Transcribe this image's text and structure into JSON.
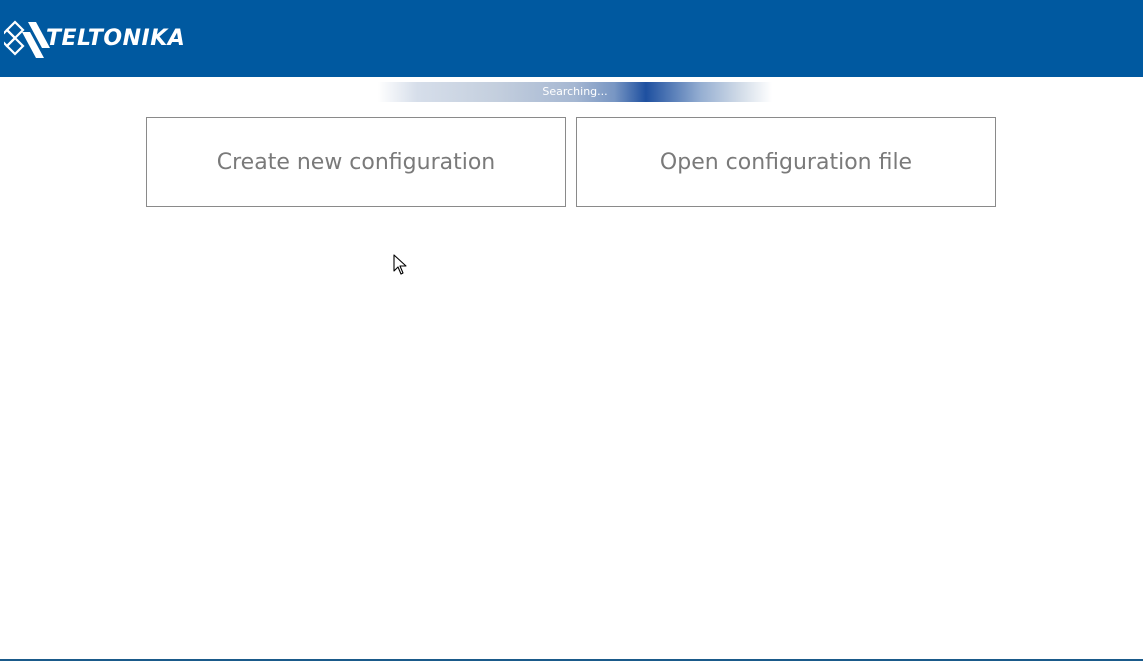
{
  "header": {
    "logo_text": "TELTONIKA",
    "background_color": "#0059a0",
    "logo_icon": "teltonika-logo-icon"
  },
  "status": {
    "progress_label": "Searching..."
  },
  "actions": {
    "create_label": "Create new configuration",
    "open_label": "Open configuration file"
  }
}
